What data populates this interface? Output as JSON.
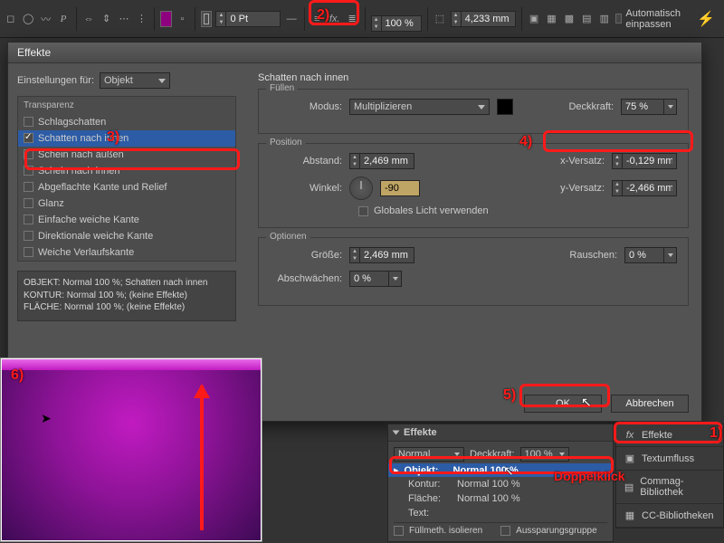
{
  "toolbar": {
    "stroke": "0 Pt",
    "measure": "4,233 mm",
    "percent": "100 %",
    "autofit": "Automatisch einpassen"
  },
  "dialog": {
    "title": "Effekte",
    "settings_for": "Einstellungen für:",
    "target": "Objekt",
    "group_title": "Transparenz",
    "items": [
      "Schlagschatten",
      "Schatten nach innen",
      "Schein nach außen",
      "Schein nach innen",
      "Abgeflachte Kante und Relief",
      "Glanz",
      "Einfache weiche Kante",
      "Direktionale weiche Kante",
      "Weiche Verlaufskante"
    ],
    "summary": "OBJEKT: Normal 100 %; Schatten nach innen\nKONTUR: Normal 100 %; (keine Effekte)\nFLÄCHE: Normal 100 %; (keine Effekte)",
    "section": "Schatten nach innen",
    "fill": {
      "legend": "Füllen",
      "mode_lbl": "Modus:",
      "mode": "Multiplizieren",
      "opacity_lbl": "Deckkraft:",
      "opacity": "75 %"
    },
    "position": {
      "legend": "Position",
      "distance_lbl": "Abstand:",
      "distance": "2,469 mm",
      "angle_lbl": "Winkel:",
      "angle": "-90",
      "global_light": "Globales Licht verwenden",
      "xoff_lbl": "x-Versatz:",
      "xoff": "-0,129 mm",
      "yoff_lbl": "y-Versatz:",
      "yoff": "-2,466 mm"
    },
    "options": {
      "legend": "Optionen",
      "size_lbl": "Größe:",
      "size": "2,469 mm",
      "choke_lbl": "Abschwächen:",
      "choke": "0 %",
      "noise_lbl": "Rauschen:",
      "noise": "0 %"
    },
    "ok": "OK",
    "cancel": "Abbrechen"
  },
  "panel": {
    "title": "Effekte",
    "blend": "Normal",
    "opacity_lbl": "Deckkraft:",
    "opacity": "100 %",
    "rows": {
      "object": "Objekt:",
      "object_val": "Normal 100 %",
      "stroke": "Kontur:",
      "stroke_val": "Normal 100 %",
      "fill": "Fläche:",
      "fill_val": "Normal 100 %",
      "text": "Text:"
    },
    "isolate": "Füllmeth. isolieren",
    "knockout": "Aussparungsgruppe"
  },
  "tabs": {
    "effects": "Effekte",
    "textwrap": "Textumfluss",
    "commag": "Commag-Bibliothek",
    "cclib": "CC-Bibliotheken"
  },
  "annot": {
    "a1": "1)",
    "a2": "2)",
    "a3": "3)",
    "a4": "4)",
    "a5": "5)",
    "a6": "6)",
    "dbl": "Doppelklick"
  }
}
